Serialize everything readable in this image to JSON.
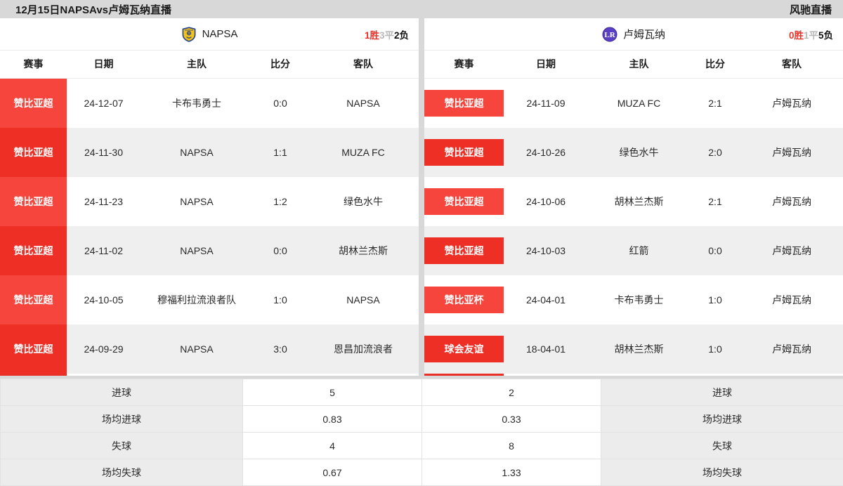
{
  "topbar": {
    "page_title": "12月15日NAPSAvs卢姆瓦纳直播",
    "site_brand": "风驰直播"
  },
  "left": {
    "team": {
      "name": "NAPSA",
      "logo_icon": "napsa-shield-icon",
      "logo_colors": {
        "fill": "#f2c21a",
        "border": "#1f3f93"
      },
      "record": {
        "win": "1胜",
        "draw": "3平",
        "loss": "2负"
      }
    },
    "columns": [
      "赛事",
      "日期",
      "主队",
      "比分",
      "客队"
    ],
    "rows": [
      {
        "league": "赞比亚超",
        "date": "24-12-07",
        "home": "卡布韦勇士",
        "score": "0:0",
        "away": "NAPSA"
      },
      {
        "league": "赞比亚超",
        "date": "24-11-30",
        "home": "NAPSA",
        "score": "1:1",
        "away": "MUZA FC"
      },
      {
        "league": "赞比亚超",
        "date": "24-11-23",
        "home": "NAPSA",
        "score": "1:2",
        "away": "绿色水牛"
      },
      {
        "league": "赞比亚超",
        "date": "24-11-02",
        "home": "NAPSA",
        "score": "0:0",
        "away": "胡林兰杰斯"
      },
      {
        "league": "赞比亚超",
        "date": "24-10-05",
        "home": "穆福利拉流浪者队",
        "score": "1:0",
        "away": "NAPSA"
      },
      {
        "league": "赞比亚超",
        "date": "24-09-29",
        "home": "NAPSA",
        "score": "3:0",
        "away": "恩昌加流浪者"
      }
    ]
  },
  "right": {
    "team": {
      "name": "卢姆瓦纳",
      "logo_icon": "lumwana-circle-icon",
      "logo_colors": {
        "fill": "#5b3fc4",
        "text": "#ffffff"
      },
      "record": {
        "win": "0胜",
        "draw": "1平",
        "loss": "5负"
      }
    },
    "columns": [
      "赛事",
      "日期",
      "主队",
      "比分",
      "客队"
    ],
    "rows": [
      {
        "league": "赞比亚超",
        "date": "24-11-09",
        "home": "MUZA FC",
        "score": "2:1",
        "away": "卢姆瓦纳"
      },
      {
        "league": "赞比亚超",
        "date": "24-10-26",
        "home": "绿色水牛",
        "score": "2:0",
        "away": "卢姆瓦纳"
      },
      {
        "league": "赞比亚超",
        "date": "24-10-06",
        "home": "胡林兰杰斯",
        "score": "2:1",
        "away": "卢姆瓦纳"
      },
      {
        "league": "赞比亚超",
        "date": "24-10-03",
        "home": "红箭",
        "score": "0:0",
        "away": "卢姆瓦纳"
      },
      {
        "league": "赞比亚杯",
        "date": "24-04-01",
        "home": "卡布韦勇士",
        "score": "1:0",
        "away": "卢姆瓦纳"
      },
      {
        "league": "球会友谊",
        "date": "18-04-01",
        "home": "胡林兰杰斯",
        "score": "1:0",
        "away": "卢姆瓦纳"
      }
    ]
  },
  "stats": {
    "rows": [
      {
        "label_left": "进球",
        "value_left": "5",
        "value_right": "2",
        "label_right": "进球"
      },
      {
        "label_left": "场均进球",
        "value_left": "0.83",
        "value_right": "0.33",
        "label_right": "场均进球"
      },
      {
        "label_left": "失球",
        "value_left": "4",
        "value_right": "8",
        "label_right": "失球"
      },
      {
        "label_left": "场均失球",
        "value_left": "0.67",
        "value_right": "1.33",
        "label_right": "场均失球"
      }
    ]
  },
  "theme": {
    "accent_red": "#ea2f27",
    "badge_red_light": "#f5453d",
    "badge_red_dark": "#ed2f26",
    "page_bg": "#d8d8d8",
    "row_alt_bg": "#efefef"
  }
}
